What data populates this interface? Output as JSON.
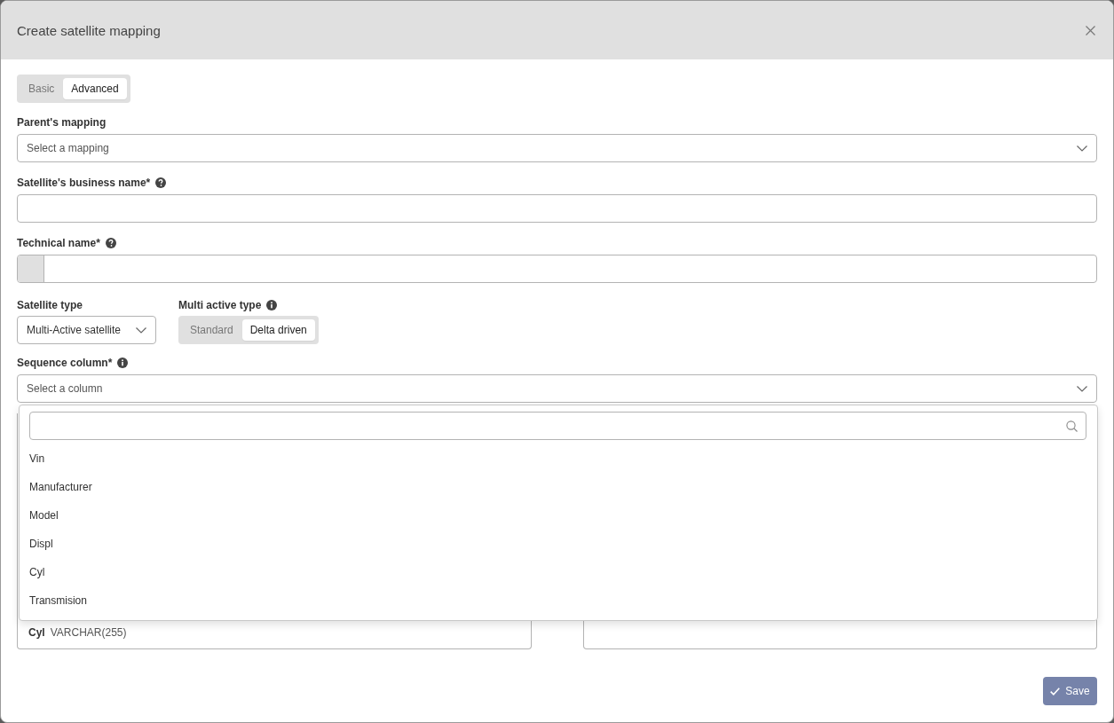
{
  "dialog": {
    "title": "Create satellite mapping"
  },
  "mode_tabs": [
    {
      "label": "Basic",
      "selected": false
    },
    {
      "label": "Advanced",
      "selected": true
    }
  ],
  "parent_mapping": {
    "label": "Parent's mapping",
    "placeholder": "Select a mapping"
  },
  "business_name": {
    "label": "Satellite's business name*"
  },
  "technical_name": {
    "label": "Technical name*"
  },
  "satellite_type": {
    "label": "Satellite type",
    "value": "Multi-Active satellite"
  },
  "multi_active_type": {
    "label": "Multi active type",
    "options": [
      {
        "label": "Standard",
        "selected": false
      },
      {
        "label": "Delta driven",
        "selected": true
      }
    ]
  },
  "sequence_column": {
    "label": "Sequence column*",
    "placeholder": "Select a column",
    "expanded": true,
    "options": [
      "Vin",
      "Manufacturer",
      "Model",
      "Displ",
      "Cyl",
      "Transmision"
    ]
  },
  "column_list": {
    "rows": [
      {
        "name": "Cyl",
        "type": "VARCHAR(255)"
      }
    ]
  },
  "save_button": {
    "label": "Save"
  }
}
